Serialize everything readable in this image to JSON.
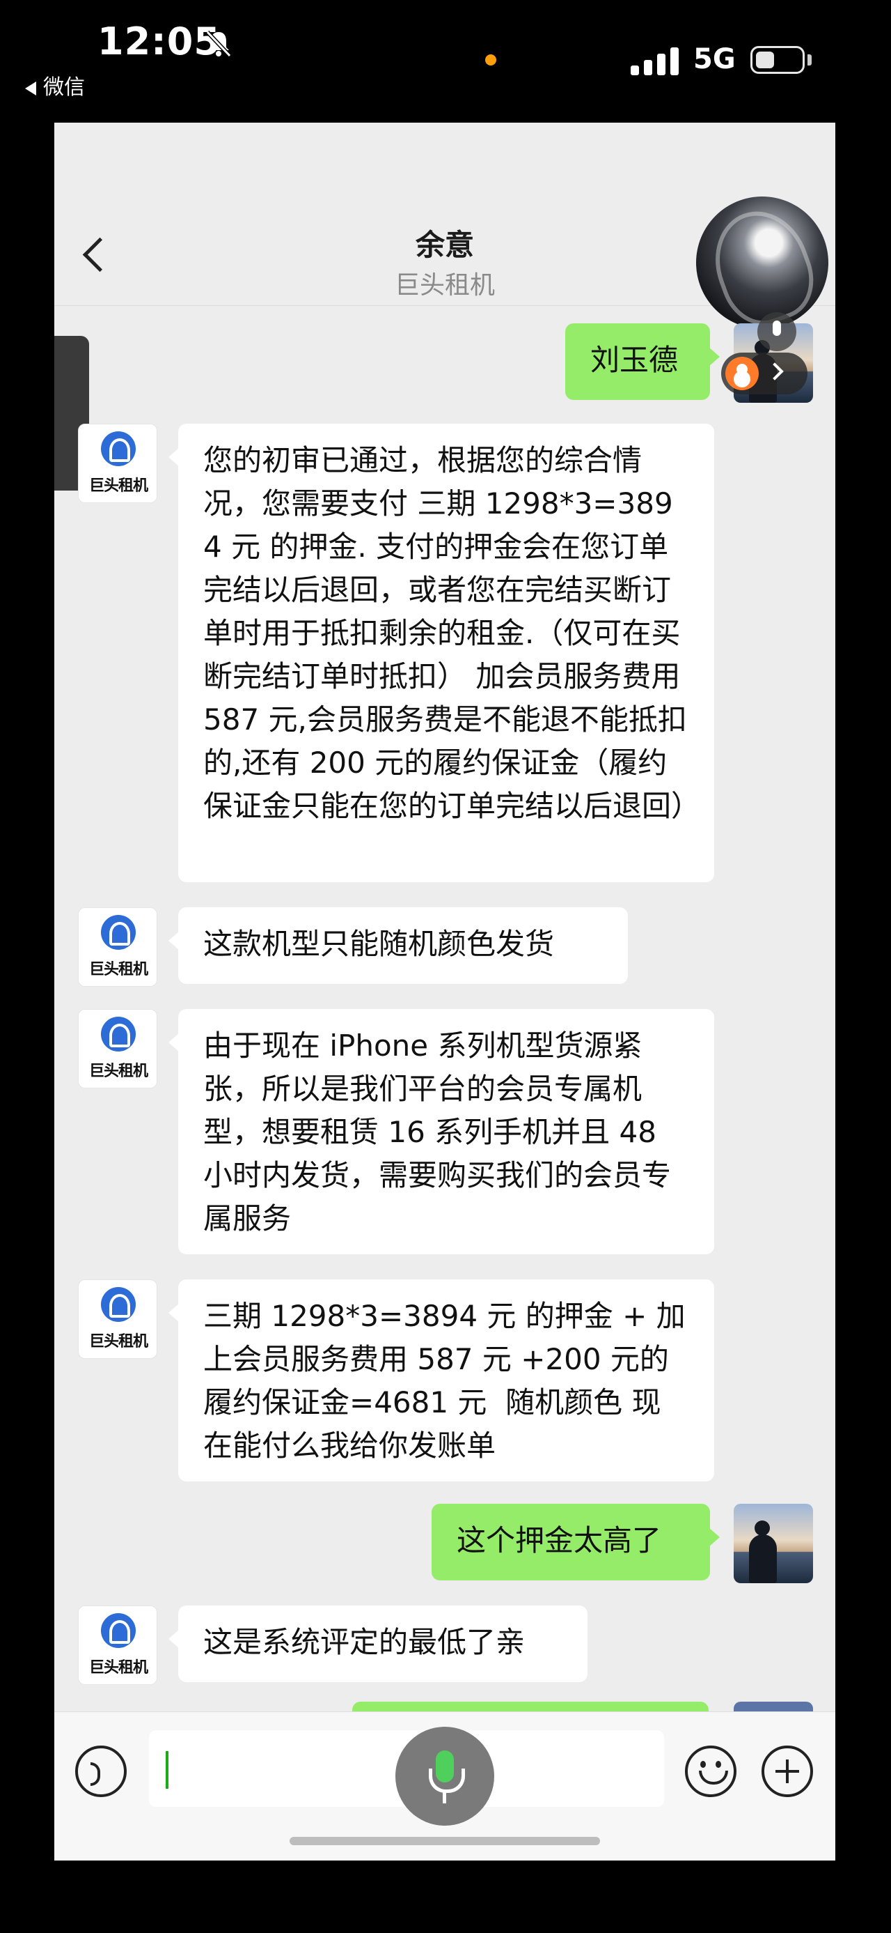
{
  "status_bar": {
    "time": "12:05",
    "back_app": "微信",
    "network": "5G"
  },
  "chat": {
    "title": "余意",
    "subtitle": "巨头租机",
    "brand_avatar_text": "巨头租机",
    "messages": [
      {
        "side": "right",
        "text": "刘玉德"
      },
      {
        "side": "left",
        "text": "您的初审已通过，根据您的综合情况，您需要支付 三期 1298*3=3894 元 的押金. 支付的押金会在您订单完结以后退回，或者您在完结买断订单时用于抵扣剩余的租金.（仅可在买断完结订单时抵扣） 加会员服务费用 587 元,会员服务费是不能退不能抵扣的,还有 200 元的履约保证金（履约保证金只能在您的订单完结以后退回）"
      },
      {
        "side": "left",
        "text": "这款机型只能随机颜色发货"
      },
      {
        "side": "left",
        "text": "由于现在 iPhone 系列机型货源紧张，所以是我们平台的会员专属机型，想要租赁 16 系列手机并且 48 小时内发货，需要购买我们的会员专属服务"
      },
      {
        "side": "left",
        "text": "三期 1298*3=3894 元 的押金 + 加上会员服务费用 587 元 +200 元的履约保证金=4681 元  随机颜色 现在能付么我给你发账单"
      },
      {
        "side": "right",
        "text": "这个押金太高了"
      },
      {
        "side": "left",
        "text": "这是系统评定的最低了亲"
      }
    ]
  }
}
